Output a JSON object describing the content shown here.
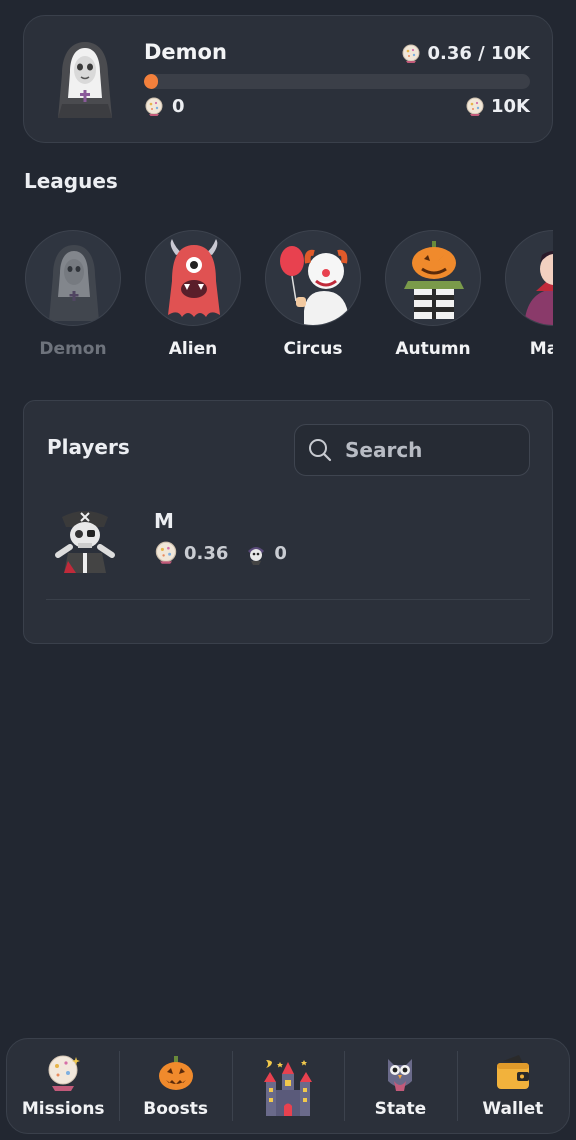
{
  "current_league": {
    "name": "Demon",
    "progress_text": "0.36 / 10K",
    "progress_fraction": 0.036,
    "min_value": "0",
    "max_value": "10K",
    "accent_color": "#f3803c"
  },
  "leagues": {
    "title": "Leagues",
    "items": [
      {
        "label": "Demon",
        "icon": "nun-icon"
      },
      {
        "label": "Alien",
        "icon": "alien-monster-icon"
      },
      {
        "label": "Circus",
        "icon": "clown-icon"
      },
      {
        "label": "Autumn",
        "icon": "pumpkin-scarecrow-icon"
      },
      {
        "label": "Magi",
        "icon": "vampire-icon"
      }
    ]
  },
  "players": {
    "title": "Players",
    "search_placeholder": "Search",
    "list": [
      {
        "name": "M",
        "coins": "0.36",
        "referrals": "0"
      }
    ]
  },
  "nav": {
    "items": [
      {
        "label": "Missions",
        "icon": "crystal-ball-icon"
      },
      {
        "label": "Boosts",
        "icon": "jack-o-lantern-icon"
      },
      {
        "label": "",
        "icon": "haunted-castle-icon"
      },
      {
        "label": "State",
        "icon": "owl-icon"
      },
      {
        "label": "Wallet",
        "icon": "wallet-icon"
      }
    ]
  }
}
